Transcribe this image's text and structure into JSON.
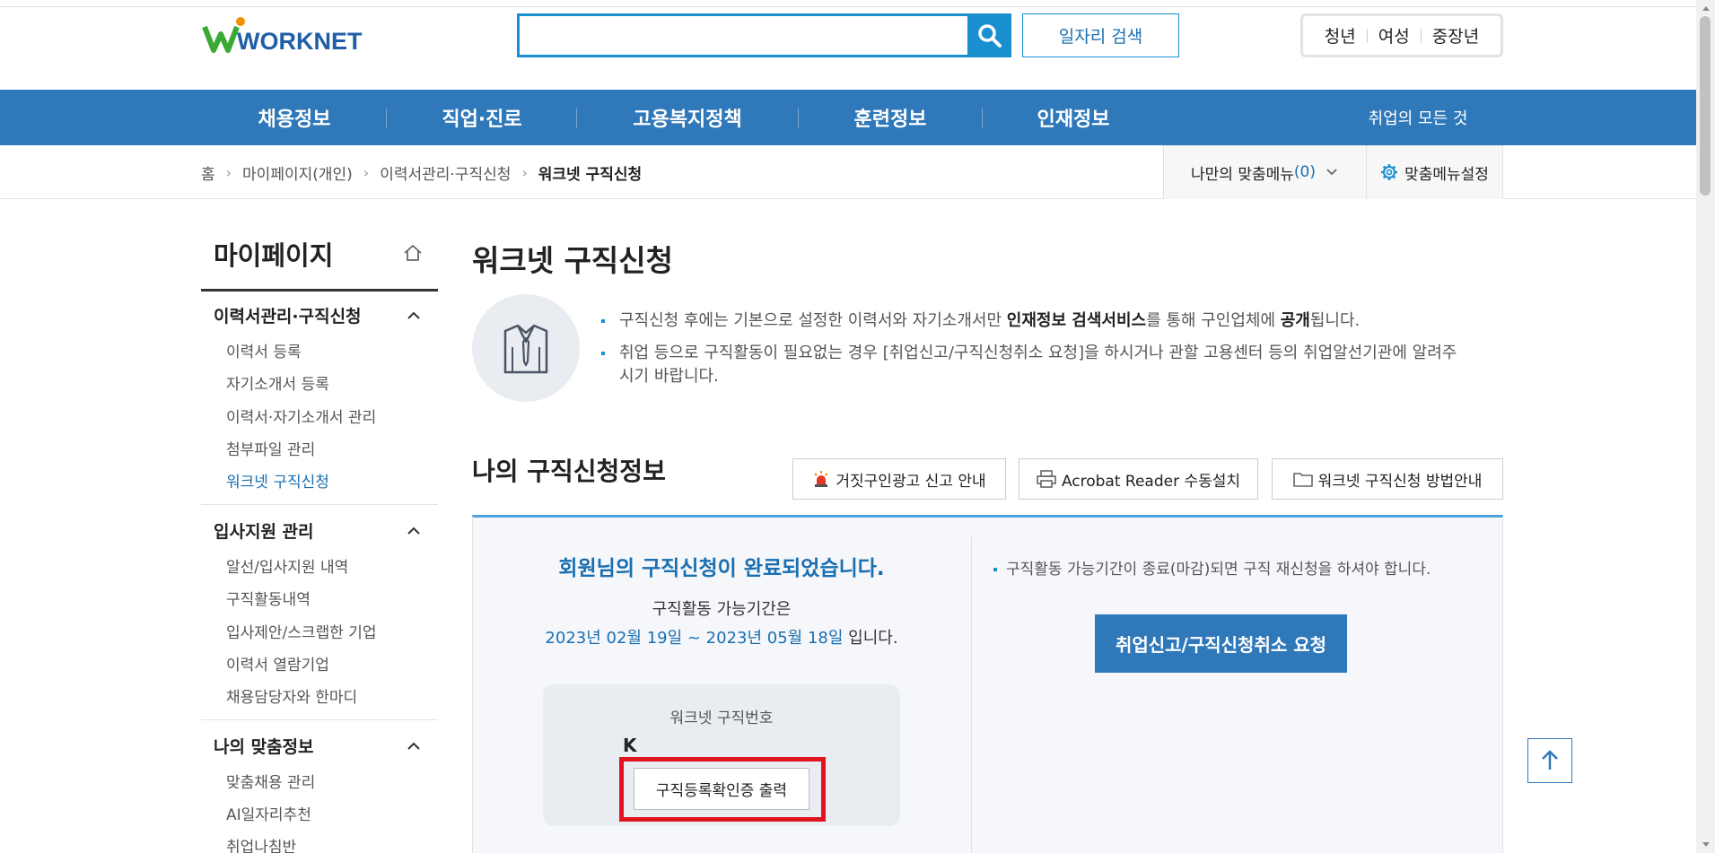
{
  "header": {
    "logo_text": "WORKNET",
    "search_placeholder": "",
    "search_value": "",
    "job_search_label": "일자리 검색",
    "quick_links": [
      "청년",
      "여성",
      "중장년"
    ]
  },
  "nav": {
    "items": [
      "채용정보",
      "직업·진로",
      "고용복지정책",
      "훈련정보",
      "인재정보"
    ],
    "all_label": "취업의 모든 것"
  },
  "breadcrumb": {
    "items": [
      "홈",
      "마이페이지(개인)",
      "이력서관리·구직신청",
      "워크넷 구직신청"
    ],
    "my_menu_label": "나만의 맞춤메뉴",
    "my_menu_count": "(0)",
    "menu_setting_label": "맞춤메뉴설정"
  },
  "sidebar": {
    "title": "마이페이지",
    "sections": [
      {
        "label": "이력서관리·구직신청",
        "items": [
          "이력서 등록",
          "자기소개서 등록",
          "이력서·자기소개서 관리",
          "첨부파일 관리",
          "워크넷 구직신청"
        ]
      },
      {
        "label": "입사지원 관리",
        "items": [
          "알선/입사지원 내역",
          "구직활동내역",
          "입사제안/스크랩한 기업",
          "이력서 열람기업",
          "채용담당자와 한마디"
        ]
      },
      {
        "label": "나의 맞춤정보",
        "items": [
          "맞춤채용 관리",
          "AI일자리추천",
          "취업나침반"
        ]
      }
    ]
  },
  "main": {
    "title": "워크넷 구직신청",
    "info1_pre": "구직신청 후에는 기본으로 설정한 이력서와 자기소개서만 ",
    "info1_bold": "인재정보 검색서비스",
    "info1_mid": "를 통해 구인업체에 ",
    "info1_bold2": "공개",
    "info1_post": "됩니다.",
    "info2_line1": "취업 등으로 구직활동이 필요없는 경우 [취업신고/구직신청취소 요청]을 하시거나 관할 고용센터 등의 취업알선기관에 알려주",
    "info2_line2": "시기 바랍니다.",
    "section_title": "나의 구직신청정보",
    "buttons": {
      "fake_ad": "거짓구인광고 신고 안내",
      "acrobat": "Acrobat Reader 수동설치",
      "guide": "워크넷 구직신청 방법안내"
    },
    "done_message": "회원님의 구직신청이 완료되었습니다.",
    "period_label": "구직활동 가능기간은",
    "period_value": "2023년 02월 19일 ~ 2023년 05월 18일",
    "period_suffix": " 입니다.",
    "jobseeker_number_label": "워크넷 구직번호",
    "jobseeker_number": "K",
    "print_button": "구직등록확인증 출력",
    "right_note": "구직활동 가능기간이 종료(마감)되면 구직 재신청을 하셔야 합니다.",
    "cancel_button": "취업신고/구직신청취소 요청"
  },
  "colors": {
    "nav_blue": "#2f78b9",
    "accent_blue": "#1a8fd0",
    "text_blue": "#1a6fb0",
    "highlight_red": "#e0141e"
  },
  "icons": [
    "search-icon",
    "home-icon",
    "chevron-up-icon",
    "gear-icon",
    "siren-icon",
    "printer-icon",
    "folder-icon",
    "shirt-tie-icon",
    "arrow-up-icon"
  ]
}
